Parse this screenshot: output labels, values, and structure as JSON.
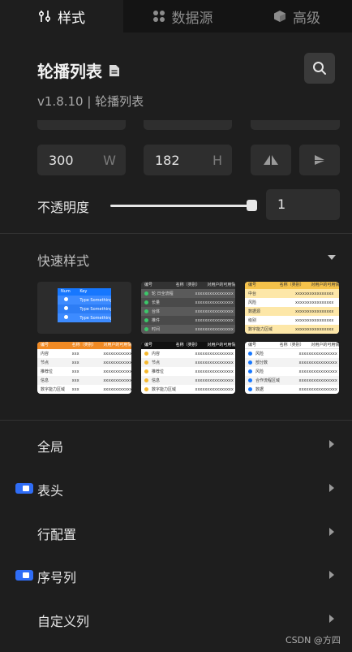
{
  "tabs": [
    {
      "label": "样式",
      "icon": "sliders-icon"
    },
    {
      "label": "数据源",
      "icon": "dots-grid-icon"
    },
    {
      "label": "高级",
      "icon": "cube-icon"
    }
  ],
  "header": {
    "title": "轮播列表",
    "version": "v1.8.10 | 轮播列表"
  },
  "size": {
    "width_value": "300",
    "width_unit": "W",
    "height_value": "182",
    "height_unit": "H"
  },
  "opacity": {
    "label": "不透明度",
    "value": "1",
    "level": 1
  },
  "quick_style": {
    "title": "快速样式",
    "thumb1": {
      "header": [
        "Num",
        "Key"
      ],
      "rows": [
        "Type Something",
        "Type Something",
        "Type Something"
      ]
    },
    "thumb2": {
      "header": [
        "编号",
        "名称（类别）",
        "对用户的可用情况"
      ],
      "rows": [
        "轮 日全流程",
        "长量",
        "台体",
        "推件",
        "时间"
      ]
    },
    "thumb3": {
      "header": [
        "编号",
        "名称（类别）",
        "对用户的可用情况"
      ],
      "rows": [
        "中台",
        "风险",
        "数据源",
        "级别",
        "数字能力区域"
      ]
    },
    "thumb4": {
      "header": [
        "编号",
        "名称（类别）",
        "对用户的可用情况"
      ],
      "rows": [
        "内容",
        "节点",
        "推荐位",
        "信息",
        "数字能力区域"
      ]
    },
    "thumb5": {
      "header": [
        "编号",
        "名称（类别）",
        "对用户的可用情况"
      ],
      "rows": [
        "内容",
        "节点",
        "推荐位",
        "信息",
        "数字能力区域"
      ]
    },
    "thumb6": {
      "header": [
        "编号",
        "名称（类别）",
        "对用户的可用情况"
      ],
      "rows": [
        "风险",
        "部分数",
        "风险",
        "合作流程区域",
        "数据"
      ]
    },
    "cell_mask": "xxxxxxxxxxxxxxxx",
    "cell_small": "xxx"
  },
  "menu": [
    {
      "label": "全局",
      "has_toggle": false
    },
    {
      "label": "表头",
      "has_toggle": true
    },
    {
      "label": "行配置",
      "has_toggle": false
    },
    {
      "label": "序号列",
      "has_toggle": true
    },
    {
      "label": "自定义列",
      "has_toggle": false
    }
  ],
  "watermark": "CSDN @方四",
  "colors": {
    "background": "#1e1e1e",
    "tab_bar": "#141414",
    "input": "#2e2e2e",
    "accent_blue": "#2f6df6",
    "orange": "#f08a24",
    "yellow": "#f5c24a"
  }
}
